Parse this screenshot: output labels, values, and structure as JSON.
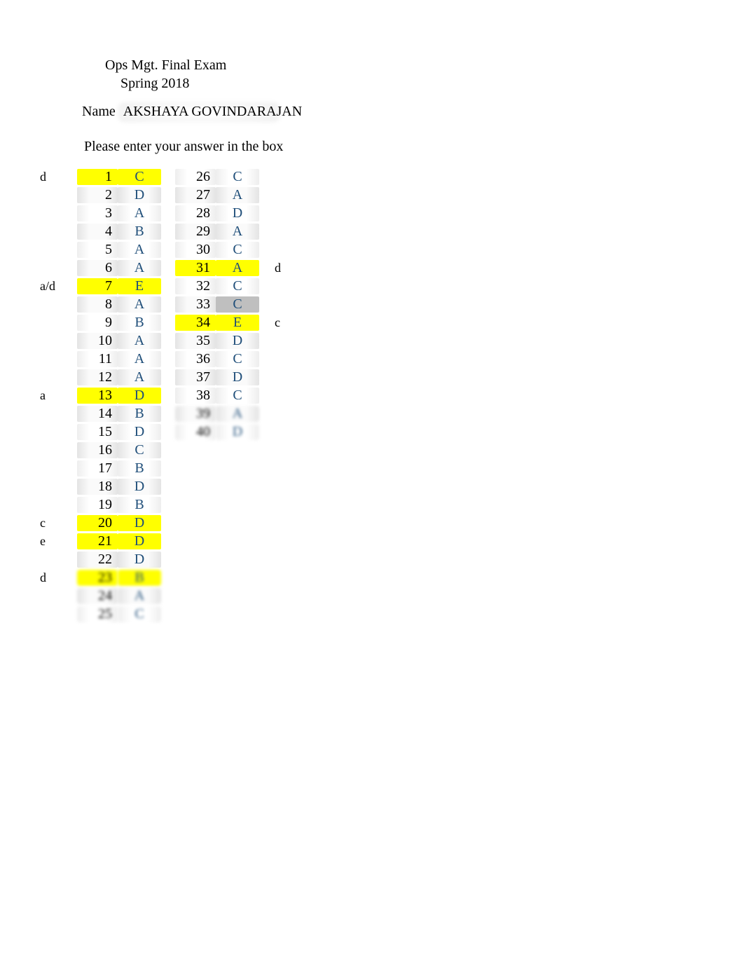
{
  "title": {
    "line1": "Ops Mgt. Final Exam",
    "line2": "Spring 2018"
  },
  "name": {
    "label": "Name",
    "value": "AKSHAYA GOVINDARAJAN"
  },
  "instruction": "Please enter your answer in the box",
  "left_annotations": [
    {
      "row": 1,
      "text": "d"
    },
    {
      "row": 7,
      "text": "a/d"
    },
    {
      "row": 13,
      "text": "a"
    },
    {
      "row": 20,
      "text": "c"
    },
    {
      "row": 21,
      "text": "e"
    },
    {
      "row": 23,
      "text": "d"
    }
  ],
  "right_annotations": [
    {
      "row": 31,
      "text": "d"
    },
    {
      "row": 34,
      "text": "c"
    }
  ],
  "col1": [
    {
      "q": 1,
      "a": "C",
      "hl": "yellow"
    },
    {
      "q": 2,
      "a": "D",
      "hl": ""
    },
    {
      "q": 3,
      "a": "A",
      "hl": ""
    },
    {
      "q": 4,
      "a": "B",
      "hl": ""
    },
    {
      "q": 5,
      "a": "A",
      "hl": ""
    },
    {
      "q": 6,
      "a": "A",
      "hl": ""
    },
    {
      "q": 7,
      "a": "E",
      "hl": "yellow"
    },
    {
      "q": 8,
      "a": "A",
      "hl": ""
    },
    {
      "q": 9,
      "a": "B",
      "hl": ""
    },
    {
      "q": 10,
      "a": "A",
      "hl": ""
    },
    {
      "q": 11,
      "a": "A",
      "hl": ""
    },
    {
      "q": 12,
      "a": "A",
      "hl": ""
    },
    {
      "q": 13,
      "a": "D",
      "hl": "yellow"
    },
    {
      "q": 14,
      "a": "B",
      "hl": ""
    },
    {
      "q": 15,
      "a": "D",
      "hl": ""
    },
    {
      "q": 16,
      "a": "C",
      "hl": ""
    },
    {
      "q": 17,
      "a": "B",
      "hl": ""
    },
    {
      "q": 18,
      "a": "D",
      "hl": ""
    },
    {
      "q": 19,
      "a": "B",
      "hl": ""
    },
    {
      "q": 20,
      "a": "D",
      "hl": "yellow"
    },
    {
      "q": 21,
      "a": "D",
      "hl": "yellow"
    },
    {
      "q": 22,
      "a": "D",
      "hl": ""
    },
    {
      "q": 23,
      "a": "B",
      "hl": "yellow"
    },
    {
      "q": 24,
      "a": "A",
      "hl": ""
    },
    {
      "q": 25,
      "a": "C",
      "hl": ""
    }
  ],
  "col2": [
    {
      "q": 26,
      "a": "C",
      "hl": ""
    },
    {
      "q": 27,
      "a": "A",
      "hl": ""
    },
    {
      "q": 28,
      "a": "D",
      "hl": ""
    },
    {
      "q": 29,
      "a": "A",
      "hl": ""
    },
    {
      "q": 30,
      "a": "C",
      "hl": ""
    },
    {
      "q": 31,
      "a": "A",
      "hl": "yellow"
    },
    {
      "q": 32,
      "a": "C",
      "hl": ""
    },
    {
      "q": 33,
      "a": "C",
      "hl": "gray"
    },
    {
      "q": 34,
      "a": "E",
      "hl": "yellow"
    },
    {
      "q": 35,
      "a": "D",
      "hl": ""
    },
    {
      "q": 36,
      "a": "C",
      "hl": ""
    },
    {
      "q": 37,
      "a": "D",
      "hl": ""
    },
    {
      "q": 38,
      "a": "C",
      "hl": ""
    },
    {
      "q": 39,
      "a": "A",
      "hl": ""
    },
    {
      "q": 40,
      "a": "D",
      "hl": ""
    }
  ]
}
